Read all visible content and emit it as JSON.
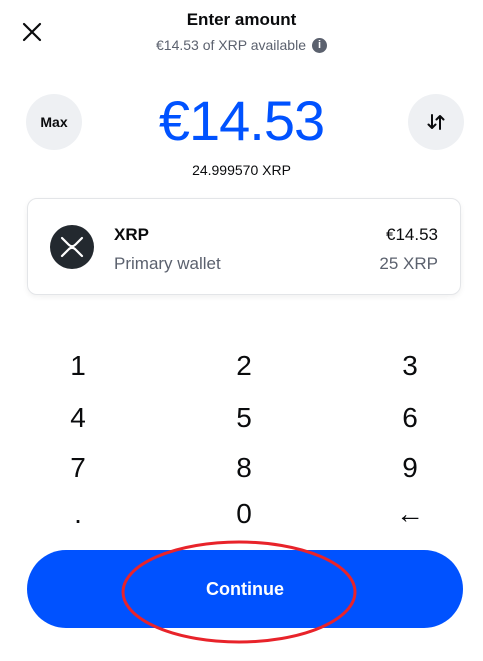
{
  "header": {
    "title": "Enter amount",
    "subtitle": "€14.53 of XRP available",
    "close_icon": "close-icon",
    "info_icon": "info-icon",
    "info_glyph": "i"
  },
  "amount": {
    "value": "€14.53",
    "crypto_equivalent": "24.999570 XRP",
    "max_label": "Max",
    "swap_icon": "swap-arrows-icon"
  },
  "asset": {
    "name": "XRP",
    "wallet": "Primary wallet",
    "fiat_balance": "€14.53",
    "crypto_balance": "25 XRP",
    "logo_icon": "xrp-logo-icon"
  },
  "keypad": {
    "keys": [
      "1",
      "2",
      "3",
      "4",
      "5",
      "6",
      "7",
      "8",
      "9",
      ".",
      "0",
      "←"
    ]
  },
  "continue_label": "Continue",
  "colors": {
    "accent": "#0052ff",
    "annotation": "#e8232a",
    "text_primary": "#0a0b0d",
    "text_secondary": "#5b616e"
  }
}
